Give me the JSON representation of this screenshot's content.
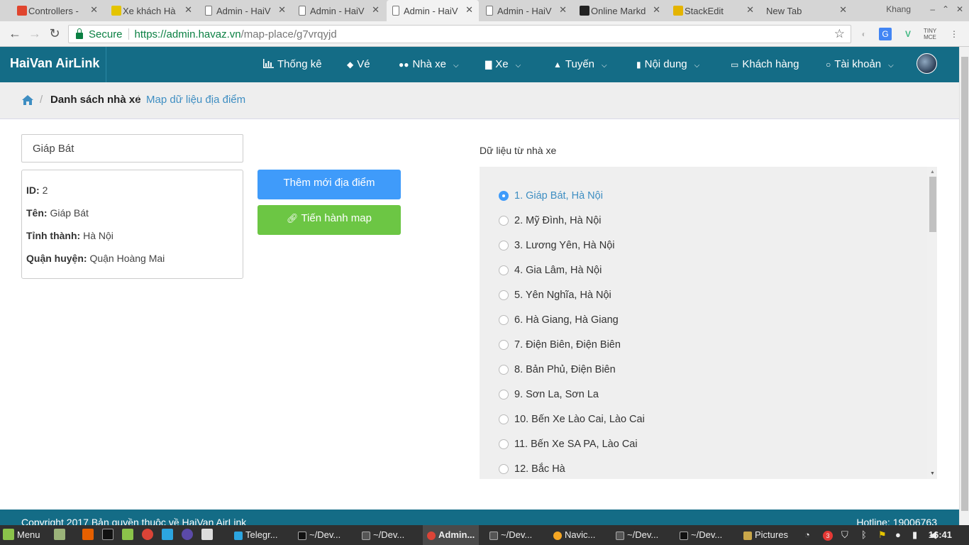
{
  "browser": {
    "tabs": [
      {
        "label": "Controllers -",
        "color": "#e0452e",
        "active": false
      },
      {
        "label": "Xe khách Hà",
        "color": "#e4c400",
        "active": false
      },
      {
        "label": "Admin - HaiV",
        "color": "#777777",
        "active": false
      },
      {
        "label": "Admin - HaiV",
        "color": "#777777",
        "active": false
      },
      {
        "label": "Admin - HaiV",
        "color": "#777777",
        "active": true
      },
      {
        "label": "Admin - HaiV",
        "color": "#777777",
        "active": false
      },
      {
        "label": "Online Markd",
        "color": "#222222",
        "active": false
      },
      {
        "label": "StackEdit",
        "color": "#e4b400",
        "active": false
      },
      {
        "label": "New Tab",
        "color": "",
        "active": false
      }
    ],
    "profile_name": "Khang",
    "secure_label": "Secure",
    "url_host": "https://admin.havaz.vn",
    "url_path": "/map-place/g7vrqyjd"
  },
  "app": {
    "brand": "HaiVan AirLink",
    "nav": [
      {
        "label": "Thống kê",
        "icon": "bar-chart-icon",
        "dropdown": false
      },
      {
        "label": "Vé",
        "icon": "ticket-icon",
        "dropdown": false
      },
      {
        "label": "Nhà xe",
        "icon": "users-icon",
        "dropdown": true
      },
      {
        "label": "Xe",
        "icon": "car-icon",
        "dropdown": true
      },
      {
        "label": "Tuyến",
        "icon": "road-icon",
        "dropdown": true
      },
      {
        "label": "Nội dung",
        "icon": "book-icon",
        "dropdown": true
      },
      {
        "label": "Khách hàng",
        "icon": "id-card-icon",
        "dropdown": false
      },
      {
        "label": "Tài khoản",
        "icon": "user-icon",
        "dropdown": true
      }
    ],
    "breadcrumb": {
      "item1": "Danh sách nhà xe",
      "item2": "Map dữ liệu địa điểm"
    },
    "search": {
      "value": "Giáp Bát"
    },
    "info": {
      "id_label": "ID:",
      "id_value": "2",
      "name_label": "Tên:",
      "name_value": "Giáp Bát",
      "province_label": "Tỉnh thành:",
      "province_value": "Hà Nội",
      "district_label": "Quận huyện:",
      "district_value": "Quận Hoàng Mai"
    },
    "buttons": {
      "add_label": "Thêm mới địa điểm",
      "map_label": "Tiến hành map"
    },
    "data_panel": {
      "title": "Dữ liệu từ nhà xe",
      "selected_index": 0,
      "options": [
        "1. Giáp Bát, Hà Nội",
        "2. Mỹ Đình, Hà Nội",
        "3. Lương Yên, Hà Nội",
        "4. Gia Lâm, Hà Nội",
        "5. Yên Nghĩa, Hà Nội",
        "6. Hà Giang, Hà Giang",
        "7. Điện Biên, Điện Biên",
        "8. Bản Phủ, Điện Biên",
        "9. Sơn La, Sơn La",
        "10. Bến Xe Lào Cai, Lào Cai",
        "11. Bến Xe SA PA, Lào Cai",
        "12. Bắc Hà"
      ]
    },
    "footer": {
      "copyright": "Copyright 2017 Bản quyền thuộc về HaiVan AirLink",
      "hotline": "Hotline: 19006763"
    }
  },
  "taskbar": {
    "menu_label": "Menu",
    "windows": [
      {
        "label": "Telegr...",
        "active": false
      },
      {
        "label": "~/Dev...",
        "active": false
      },
      {
        "label": "~/Dev...",
        "active": false
      },
      {
        "label": "Admin...",
        "active": true
      },
      {
        "label": "~/Dev...",
        "active": false
      },
      {
        "label": "Navic...",
        "active": false
      },
      {
        "label": "~/Dev...",
        "active": false
      },
      {
        "label": "~/Dev...",
        "active": false
      },
      {
        "label": "Pictures",
        "active": false
      }
    ],
    "notification_count": "3",
    "clock": "16:41"
  }
}
